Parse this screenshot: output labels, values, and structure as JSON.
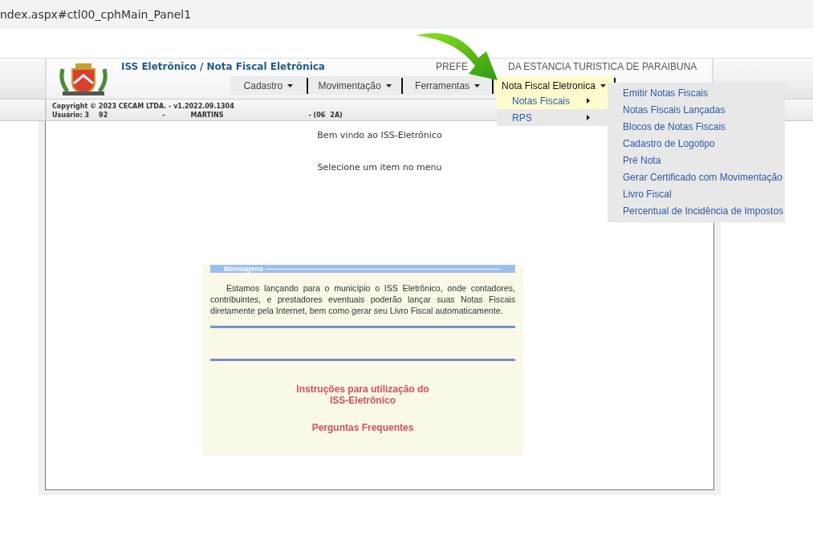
{
  "browser": {
    "address": "ndex.aspx#ctl00_cphMain_Panel1"
  },
  "header": {
    "title": "ISS Eletrônico / Nota Fiscal Eletrônica",
    "municipality_parts": [
      "PREFE",
      "DA ESTANCIA TURISTICA DE PARAIBUNA"
    ]
  },
  "menu": [
    {
      "label": "Cadastro",
      "selected": false
    },
    {
      "label": "Movimentação",
      "selected": false
    },
    {
      "label": "Ferramentas",
      "selected": false
    },
    {
      "label": "Nota Fiscal Eletronica",
      "selected": true,
      "dropdown": [
        {
          "label": "Notas Fiscais",
          "selected": true,
          "submenu": [
            "Emitir Notas Fiscais",
            "Notas Fiscais Lançadas",
            "Blocos de Notas Fiscais",
            "Cadastro de Logotipo",
            "Pré Nota",
            "Gerar Certificado com Movimentação",
            "Livro Fiscal",
            "Percentual de Incidência de Impostos"
          ]
        },
        {
          "label": "RPS",
          "selected": false
        }
      ]
    }
  ],
  "info": {
    "copyright": "Copyright © 2023 CECAM LTDA. - v1.2022.09.1304",
    "user_fields": [
      "Usuário: 3",
      "92",
      "-",
      "MARTINS",
      "- (06",
      "2A)"
    ]
  },
  "welcome": "Bem vindo ao ISS-Eletrônico",
  "prompt": "Selecione um item no menu",
  "messages": {
    "title": "Mensagens",
    "text": "Estamos lançando para o município o ISS Eletrônico, onde contadores, contribuintes, e prestadores eventuais poderão lançar suas Notas Fiscais diretamente pela Internet, bem como gerar seu Livro Fiscal automaticamente.",
    "links": [
      "Instruções para utilização do ISS-Eletrônico",
      "Perguntas Frequentes"
    ]
  }
}
